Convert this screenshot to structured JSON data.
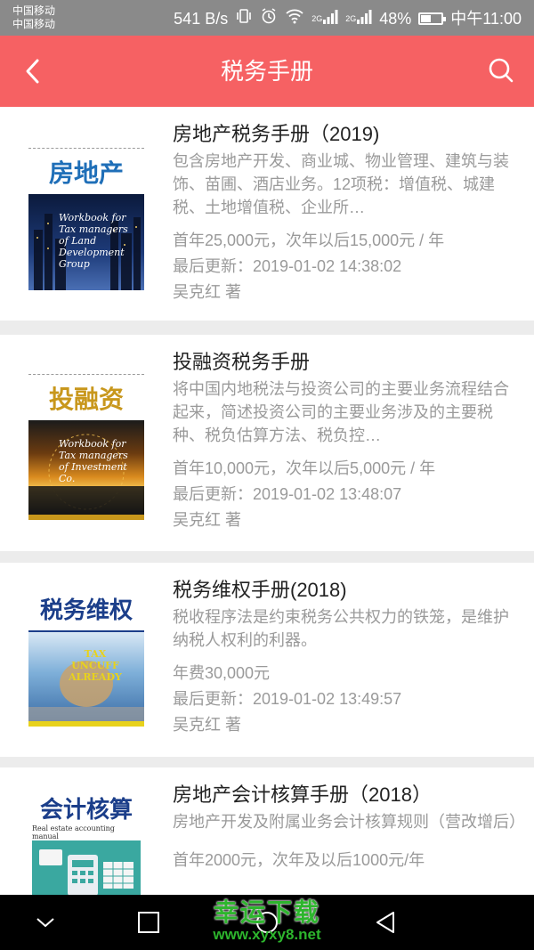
{
  "status_bar": {
    "carrier_line1": "中国移动",
    "carrier_line2": "中国移动",
    "speed": "541 B/s",
    "sig_label1": "2G",
    "sig_label2": "2G",
    "battery_text": "48%",
    "battery_level": 0.48,
    "time": "中午11:00"
  },
  "header": {
    "title": "税务手册",
    "bg_color": "#f66163"
  },
  "books": [
    {
      "cover_label": "房地产",
      "cover_label_color": "#1f6fb8",
      "cover_text": "Workbook for Tax managers of Land Development Group",
      "title": "房地产税务手册（2019)",
      "description": "包含房地产开发、商业城、物业管理、建筑与装饰、苗圃、酒店业务。12项税：增值税、城建税、土地增值税、企业所…",
      "price": "首年25,000元，次年以后15,000元 / 年",
      "updated": "最后更新：2019-01-02 14:38:02",
      "author": "吴克红 著"
    },
    {
      "cover_label": "投融资",
      "cover_label_color": "#c8971c",
      "cover_text": "Workbook for Tax managers of Investment Co.",
      "title": "投融资税务手册",
      "description": "将中国内地税法与投资公司的主要业务流程结合起来，简述投资公司的主要业务涉及的主要税种、税负估算方法、税负控…",
      "price": "首年10,000元，次年以后5,000元 / 年",
      "updated": "最后更新：2019-01-02 13:48:07",
      "author": "吴克红 著"
    },
    {
      "cover_label": "税务维权",
      "cover_label_color": "#1b3e8a",
      "cover_text": "TAX UNCUFF ALREADY",
      "title": "税务维权手册(2018)",
      "description": "税收程序法是约束税务公共权力的铁笼，是维护纳税人权利的利器。",
      "price": "年费30,000元",
      "updated": "最后更新：2019-01-02 13:49:57",
      "author": "吴克红 著"
    },
    {
      "cover_label": "会计核算",
      "cover_label_color": "#1b3e8a",
      "cover_text": "Real estate accounting manual",
      "title": "房地产会计核算手册（2018）",
      "description": "房地产开发及附属业务会计核算规则（营改增后）",
      "price": "首年2000元，次年及以后1000元/年",
      "updated": "",
      "author": ""
    }
  ],
  "watermark": {
    "line1": "幸运下载",
    "line2": "www.xyxy8.net"
  }
}
